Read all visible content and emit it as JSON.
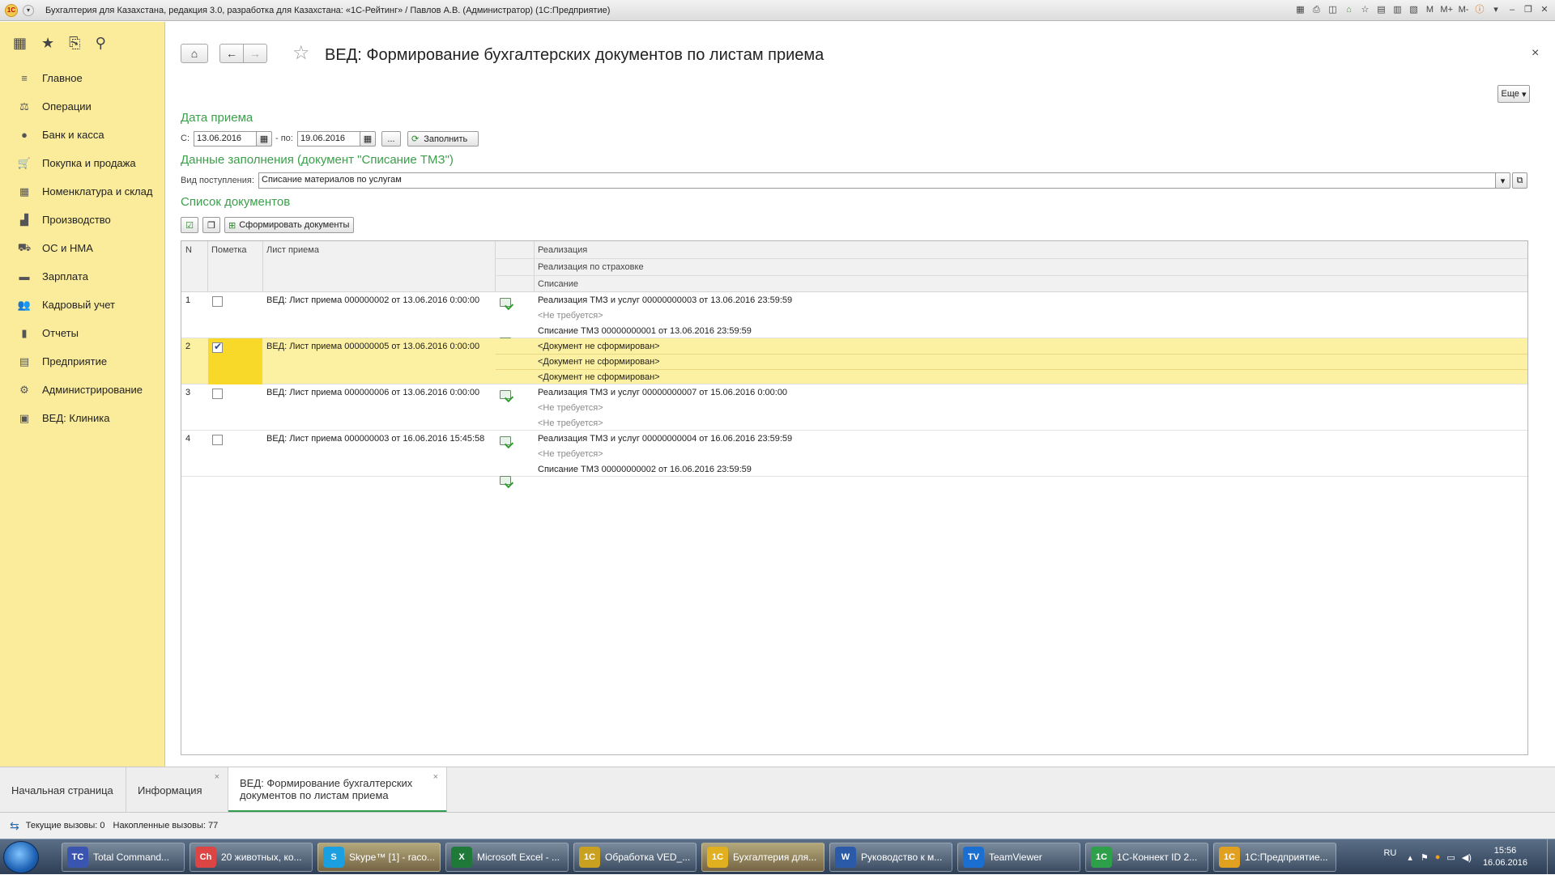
{
  "window": {
    "title": "Бухгалтерия для Казахстана, редакция 3.0, разработка для Казахстана: «1С-Рейтинг» / Павлов А.В. (Администратор)  (1С:Предприятие)",
    "tool_m": "M",
    "tool_mplus": "M+",
    "tool_mminus": "M-"
  },
  "sidebar": {
    "items": [
      {
        "label": "Главное",
        "icon": "menu-lines-icon"
      },
      {
        "label": "Операции",
        "icon": "operations-icon"
      },
      {
        "label": "Банк и касса",
        "icon": "coin-icon"
      },
      {
        "label": "Покупка и продажа",
        "icon": "cart-icon"
      },
      {
        "label": "Номенклатура и склад",
        "icon": "grid-icon"
      },
      {
        "label": "Производство",
        "icon": "factory-icon"
      },
      {
        "label": "ОС и НМА",
        "icon": "truck-icon"
      },
      {
        "label": "Зарплата",
        "icon": "wallet-icon"
      },
      {
        "label": "Кадровый учет",
        "icon": "people-icon"
      },
      {
        "label": "Отчеты",
        "icon": "bar-chart-icon"
      },
      {
        "label": "Предприятие",
        "icon": "building-icon"
      },
      {
        "label": "Администрирование",
        "icon": "gear-icon"
      },
      {
        "label": "ВЕД: Клиника",
        "icon": "clinic-icon"
      }
    ]
  },
  "form": {
    "title": "ВЕД: Формирование бухгалтерских документов по листам приема",
    "more_button": "Еще",
    "date_section": "Дата приема",
    "from_label": "С:",
    "from_value": "13.06.2016",
    "to_label": "- по:",
    "to_value": "19.06.2016",
    "ellipsis": "...",
    "fill_button": "Заполнить",
    "fill_section": "Данные заполнения (документ \"Списание ТМЗ\")",
    "receipt_label": "Вид поступления:",
    "receipt_value": "Списание материалов по услугам",
    "list_section": "Список документов",
    "generate_button": "Сформировать документы"
  },
  "table": {
    "headers": {
      "n": "N",
      "mark": "Пометка",
      "sheet": "Лист приема",
      "realization": "Реализация",
      "insurance": "Реализация по страховке",
      "writeoff": "Списание"
    },
    "rows": [
      {
        "n": "1",
        "checked": false,
        "sheet": "ВЕД: Лист приема 000000002 от 13.06.2016 0:00:00",
        "realization": "Реализация ТМЗ и услуг 00000000003 от 13.06.2016 23:59:59",
        "insurance": "<Не требуется>",
        "writeoff": "Списание ТМЗ 00000000001 от 13.06.2016 23:59:59"
      },
      {
        "n": "2",
        "checked": true,
        "sheet": "ВЕД: Лист приема 000000005 от 13.06.2016 0:00:00",
        "realization": "<Документ не сформирован>",
        "insurance": "<Документ не сформирован>",
        "writeoff": "<Документ не сформирован>"
      },
      {
        "n": "3",
        "checked": false,
        "sheet": "ВЕД: Лист приема 000000006 от 13.06.2016 0:00:00",
        "realization": "Реализация ТМЗ и услуг 00000000007 от 15.06.2016 0:00:00",
        "insurance": "<Не требуется>",
        "writeoff": "<Не требуется>"
      },
      {
        "n": "4",
        "checked": false,
        "sheet": "ВЕД: Лист приема 000000003 от 16.06.2016 15:45:58",
        "realization": "Реализация ТМЗ и услуг 00000000004 от 16.06.2016 23:59:59",
        "insurance": "<Не требуется>",
        "writeoff": "Списание ТМЗ 00000000002 от 16.06.2016 23:59:59"
      }
    ]
  },
  "tabs": {
    "home": "Начальная страница",
    "info": "Информация",
    "current_line1": "ВЕД: Формирование бухгалтерских",
    "current_line2": "документов по листам приема"
  },
  "status": {
    "current_calls": "Текущие вызовы: 0",
    "accumulated_calls": "Накопленные вызовы: 77"
  },
  "taskbar": {
    "items": [
      {
        "label": "Total Command...",
        "color": "#3a55b0",
        "icon": "TC"
      },
      {
        "label": "20 животных, ко...",
        "color": "#d44",
        "icon": "Ch"
      },
      {
        "label": "Skype™ [1] - raco...",
        "color": "#1aa0e0",
        "icon": "S"
      },
      {
        "label": "Microsoft Excel - ...",
        "color": "#1f7a3a",
        "icon": "X"
      },
      {
        "label": "Обработка VED_...",
        "color": "#c9a020",
        "icon": "1C"
      },
      {
        "label": "Бухгалтерия для...",
        "color": "#e0b020",
        "icon": "1C"
      },
      {
        "label": "Руководство к м...",
        "color": "#2a5aa8",
        "icon": "W"
      },
      {
        "label": "TeamViewer",
        "color": "#1b6fd1",
        "icon": "TV"
      },
      {
        "label": "1С-Коннект ID 2...",
        "color": "#2ea04a",
        "icon": "1C"
      },
      {
        "label": "1С:Предприятие...",
        "color": "#e0a020",
        "icon": "1C"
      }
    ],
    "lang": "RU",
    "time": "15:56",
    "date": "16.06.2016"
  }
}
